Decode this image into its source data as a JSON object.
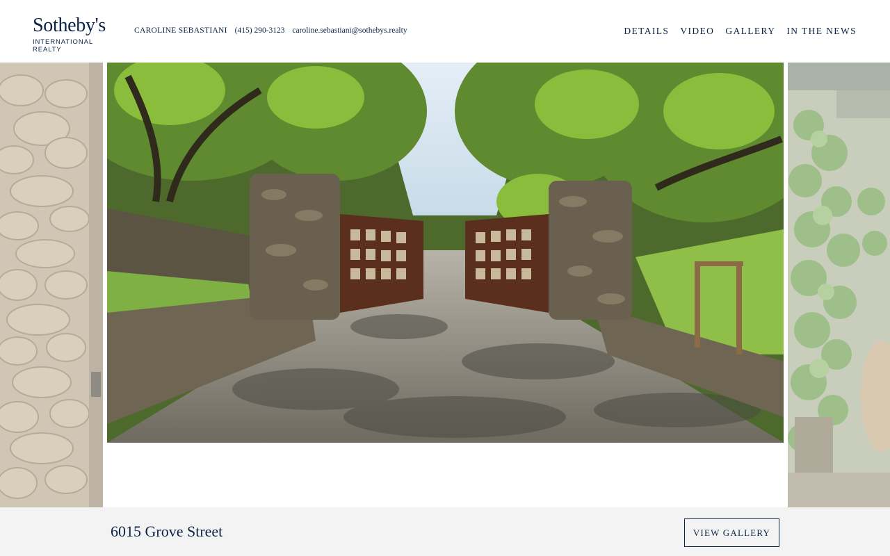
{
  "brand": {
    "name": "Sotheby's",
    "subtitle": "INTERNATIONAL REALTY"
  },
  "agent": {
    "name": "CAROLINE SEBASTIANI",
    "phone": "(415) 290-3123",
    "email": "caroline.sebastiani@sothebys.realty"
  },
  "nav": {
    "items": [
      {
        "label": "DETAILS"
      },
      {
        "label": "VIDEO"
      },
      {
        "label": "GALLERY"
      },
      {
        "label": "IN THE NEWS"
      }
    ]
  },
  "hero": {
    "media": "video-frame-stone-gate-driveway"
  },
  "footer": {
    "address": "6015 Grove Street",
    "gallery_button": "VIEW GALLERY"
  },
  "colors": {
    "brand_navy": "#0b2346",
    "footer_bg": "#f3f3f3"
  }
}
